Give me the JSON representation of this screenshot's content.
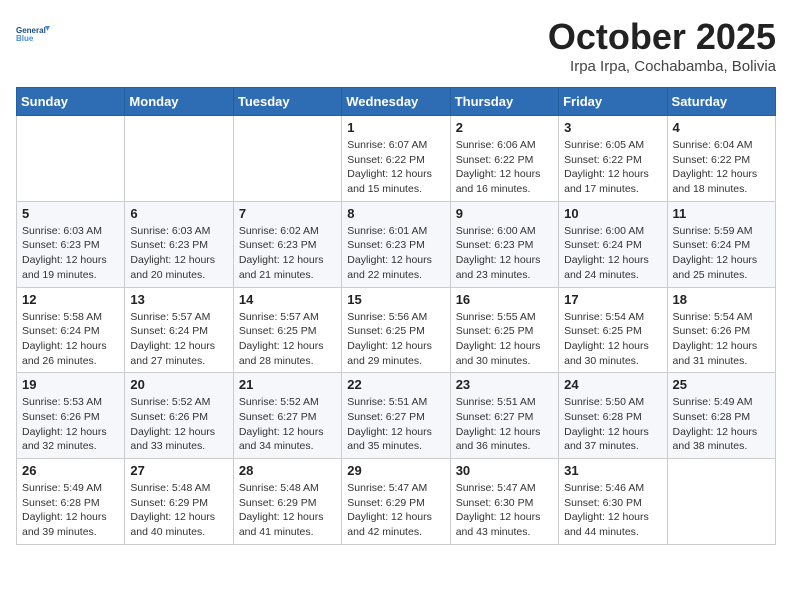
{
  "header": {
    "logo_line1": "General",
    "logo_line2": "Blue",
    "month_title": "October 2025",
    "location": "Irpa Irpa, Cochabamba, Bolivia"
  },
  "days_of_week": [
    "Sunday",
    "Monday",
    "Tuesday",
    "Wednesday",
    "Thursday",
    "Friday",
    "Saturday"
  ],
  "weeks": [
    [
      {
        "day": "",
        "info": ""
      },
      {
        "day": "",
        "info": ""
      },
      {
        "day": "",
        "info": ""
      },
      {
        "day": "1",
        "info": "Sunrise: 6:07 AM\nSunset: 6:22 PM\nDaylight: 12 hours\nand 15 minutes."
      },
      {
        "day": "2",
        "info": "Sunrise: 6:06 AM\nSunset: 6:22 PM\nDaylight: 12 hours\nand 16 minutes."
      },
      {
        "day": "3",
        "info": "Sunrise: 6:05 AM\nSunset: 6:22 PM\nDaylight: 12 hours\nand 17 minutes."
      },
      {
        "day": "4",
        "info": "Sunrise: 6:04 AM\nSunset: 6:22 PM\nDaylight: 12 hours\nand 18 minutes."
      }
    ],
    [
      {
        "day": "5",
        "info": "Sunrise: 6:03 AM\nSunset: 6:23 PM\nDaylight: 12 hours\nand 19 minutes."
      },
      {
        "day": "6",
        "info": "Sunrise: 6:03 AM\nSunset: 6:23 PM\nDaylight: 12 hours\nand 20 minutes."
      },
      {
        "day": "7",
        "info": "Sunrise: 6:02 AM\nSunset: 6:23 PM\nDaylight: 12 hours\nand 21 minutes."
      },
      {
        "day": "8",
        "info": "Sunrise: 6:01 AM\nSunset: 6:23 PM\nDaylight: 12 hours\nand 22 minutes."
      },
      {
        "day": "9",
        "info": "Sunrise: 6:00 AM\nSunset: 6:23 PM\nDaylight: 12 hours\nand 23 minutes."
      },
      {
        "day": "10",
        "info": "Sunrise: 6:00 AM\nSunset: 6:24 PM\nDaylight: 12 hours\nand 24 minutes."
      },
      {
        "day": "11",
        "info": "Sunrise: 5:59 AM\nSunset: 6:24 PM\nDaylight: 12 hours\nand 25 minutes."
      }
    ],
    [
      {
        "day": "12",
        "info": "Sunrise: 5:58 AM\nSunset: 6:24 PM\nDaylight: 12 hours\nand 26 minutes."
      },
      {
        "day": "13",
        "info": "Sunrise: 5:57 AM\nSunset: 6:24 PM\nDaylight: 12 hours\nand 27 minutes."
      },
      {
        "day": "14",
        "info": "Sunrise: 5:57 AM\nSunset: 6:25 PM\nDaylight: 12 hours\nand 28 minutes."
      },
      {
        "day": "15",
        "info": "Sunrise: 5:56 AM\nSunset: 6:25 PM\nDaylight: 12 hours\nand 29 minutes."
      },
      {
        "day": "16",
        "info": "Sunrise: 5:55 AM\nSunset: 6:25 PM\nDaylight: 12 hours\nand 30 minutes."
      },
      {
        "day": "17",
        "info": "Sunrise: 5:54 AM\nSunset: 6:25 PM\nDaylight: 12 hours\nand 30 minutes."
      },
      {
        "day": "18",
        "info": "Sunrise: 5:54 AM\nSunset: 6:26 PM\nDaylight: 12 hours\nand 31 minutes."
      }
    ],
    [
      {
        "day": "19",
        "info": "Sunrise: 5:53 AM\nSunset: 6:26 PM\nDaylight: 12 hours\nand 32 minutes."
      },
      {
        "day": "20",
        "info": "Sunrise: 5:52 AM\nSunset: 6:26 PM\nDaylight: 12 hours\nand 33 minutes."
      },
      {
        "day": "21",
        "info": "Sunrise: 5:52 AM\nSunset: 6:27 PM\nDaylight: 12 hours\nand 34 minutes."
      },
      {
        "day": "22",
        "info": "Sunrise: 5:51 AM\nSunset: 6:27 PM\nDaylight: 12 hours\nand 35 minutes."
      },
      {
        "day": "23",
        "info": "Sunrise: 5:51 AM\nSunset: 6:27 PM\nDaylight: 12 hours\nand 36 minutes."
      },
      {
        "day": "24",
        "info": "Sunrise: 5:50 AM\nSunset: 6:28 PM\nDaylight: 12 hours\nand 37 minutes."
      },
      {
        "day": "25",
        "info": "Sunrise: 5:49 AM\nSunset: 6:28 PM\nDaylight: 12 hours\nand 38 minutes."
      }
    ],
    [
      {
        "day": "26",
        "info": "Sunrise: 5:49 AM\nSunset: 6:28 PM\nDaylight: 12 hours\nand 39 minutes."
      },
      {
        "day": "27",
        "info": "Sunrise: 5:48 AM\nSunset: 6:29 PM\nDaylight: 12 hours\nand 40 minutes."
      },
      {
        "day": "28",
        "info": "Sunrise: 5:48 AM\nSunset: 6:29 PM\nDaylight: 12 hours\nand 41 minutes."
      },
      {
        "day": "29",
        "info": "Sunrise: 5:47 AM\nSunset: 6:29 PM\nDaylight: 12 hours\nand 42 minutes."
      },
      {
        "day": "30",
        "info": "Sunrise: 5:47 AM\nSunset: 6:30 PM\nDaylight: 12 hours\nand 43 minutes."
      },
      {
        "day": "31",
        "info": "Sunrise: 5:46 AM\nSunset: 6:30 PM\nDaylight: 12 hours\nand 44 minutes."
      },
      {
        "day": "",
        "info": ""
      }
    ]
  ]
}
